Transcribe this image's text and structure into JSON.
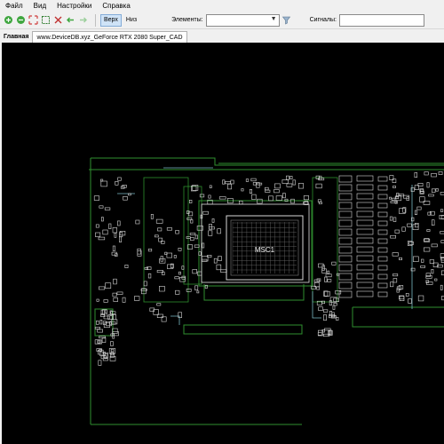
{
  "menu": {
    "file": "Файл",
    "view": "Вид",
    "settings": "Настройки",
    "help": "Справка"
  },
  "toolbar": {
    "top_label": "Верх",
    "bottom_label": "Низ",
    "elements_label": "Элементы:",
    "elements_value": "",
    "signals_label": "Сигналы:",
    "signals_value": "",
    "icons": [
      "zoom-in-icon",
      "zoom-out-icon",
      "fit-icon",
      "select-icon",
      "flip-icon",
      "back-icon",
      "forward-icon",
      "filter-icon"
    ]
  },
  "tabs": {
    "main_label": "Главная",
    "document_label": "www.DeviceDB.xyz_GeForce RTX 2080 Super_CAD"
  },
  "board": {
    "chip_label": "MSC1",
    "colors": {
      "outline": "#2f8f2f",
      "component": "#d8d8d8",
      "copper": "#7ab9c4",
      "background": "#000000"
    }
  }
}
